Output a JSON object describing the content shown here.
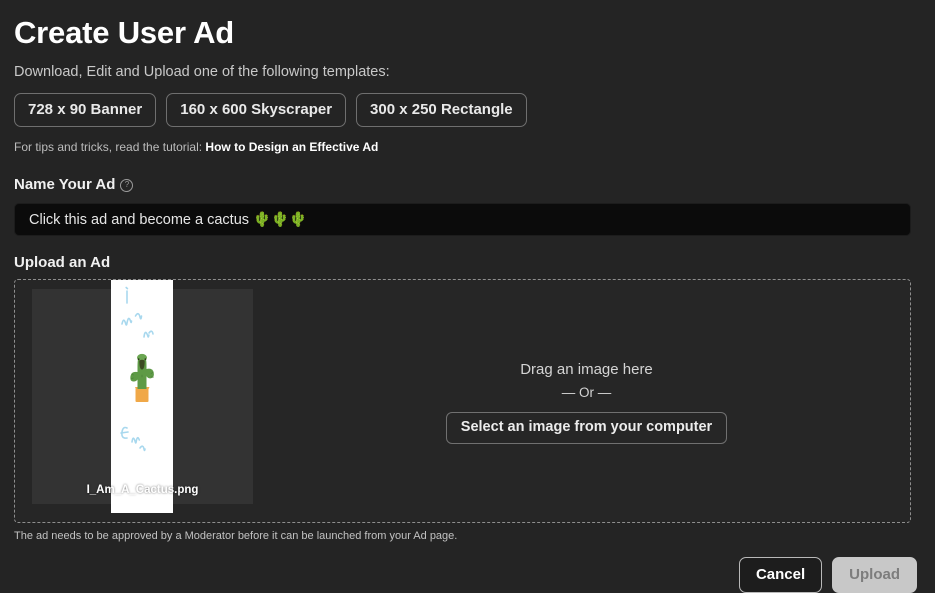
{
  "header": {
    "title": "Create User Ad",
    "subtitle": "Download, Edit and Upload one of the following templates:"
  },
  "templates": [
    {
      "label": "728 x 90 Banner"
    },
    {
      "label": "160 x 600 Skyscraper"
    },
    {
      "label": "300 x 250 Rectangle"
    }
  ],
  "tutorial": {
    "prefix": "For tips and tricks, read the tutorial: ",
    "link_label": "How to Design an Effective Ad"
  },
  "name_field": {
    "label": "Name Your Ad",
    "info_icon": "help-circle-icon",
    "value": "Click this ad and become a cactus 🌵🌵🌵",
    "placeholder": "Name Your Ad"
  },
  "upload": {
    "label": "Upload an Ad",
    "drag_text": "Drag an image here",
    "or_text": "— Or —",
    "select_button_label": "Select an image from your computer",
    "thumbnail": {
      "filename": "I_Am_A_Cactus.png",
      "handwriting_lines": [
        "i",
        "am",
        "a",
        "Cac"
      ],
      "drawing": "cactus-in-pot",
      "cactus_color": "#5a9245",
      "pot_color": "#f0a848",
      "handwriting_color": "#a8d8ee",
      "image_background": "#ffffff"
    }
  },
  "footer": {
    "note": "The ad needs to be approved by a Moderator before it can be launched from your Ad page.",
    "cancel_label": "Cancel",
    "upload_label": "Upload"
  },
  "colors": {
    "page_background": "#242424",
    "dropzone_background": "#262626",
    "input_background": "#0b0b0b",
    "border_muted": "#8e8e8e",
    "upload_button_background": "#c8c8c8",
    "emoji_green": "#9ed63a"
  }
}
